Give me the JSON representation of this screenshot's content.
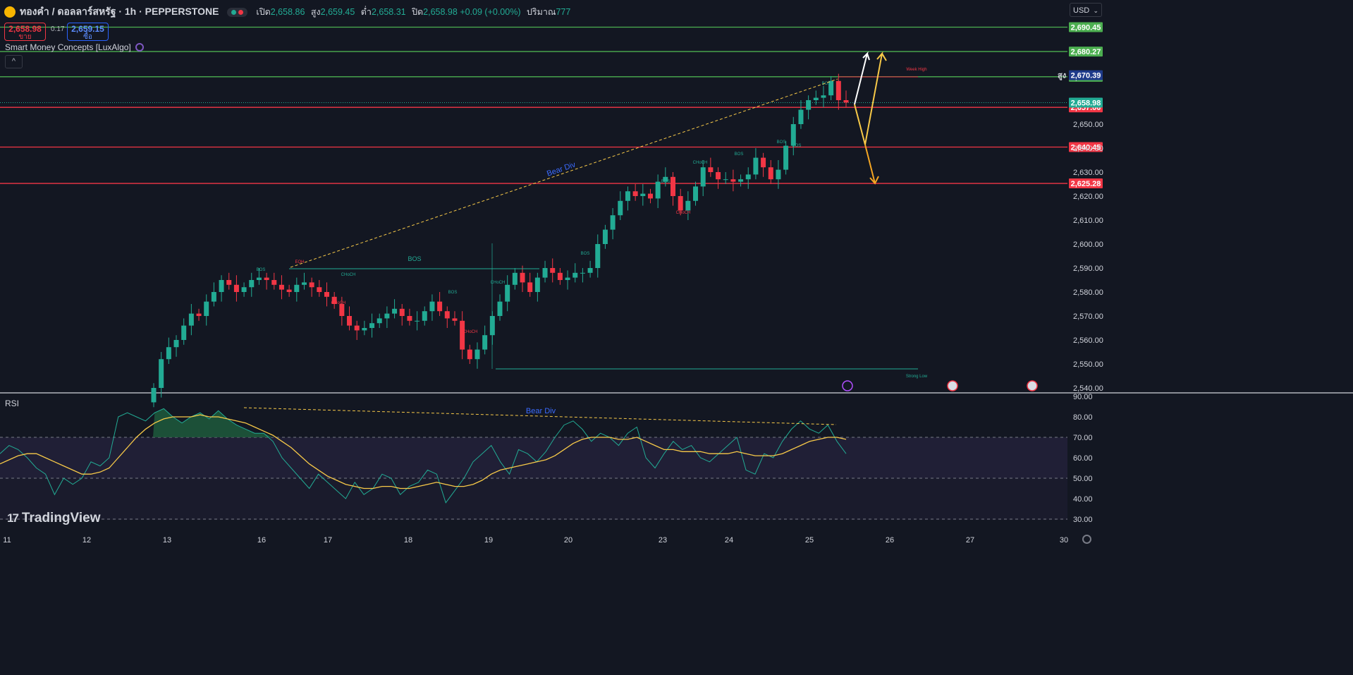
{
  "header": {
    "symbol_title": "ทองคำ / ดอลลาร์สหรัฐ · 1h · PEPPERSTONE",
    "open_label": "เปิด",
    "open_value": "2,658.86",
    "high_label": "สูง",
    "high_value": "2,659.45",
    "low_label": "ต่ำ",
    "low_value": "2,658.31",
    "close_label": "ปิด",
    "close_value": "2,658.98",
    "change_value": "+0.09 (+0.00%)",
    "volume_label": "ปริมาณ",
    "volume_value": "777"
  },
  "trade": {
    "sell_price": "2,658.98",
    "sell_label": "ขาย",
    "spread": "0.17",
    "buy_price": "2,659.15",
    "buy_label": "ซื้อ"
  },
  "currency": {
    "selected": "USD"
  },
  "indicator": {
    "name": "Smart Money Concepts [LuxAlgo]"
  },
  "rsi_panel": {
    "title": "RSI",
    "annotation": "Bear Div"
  },
  "logo": {
    "text": "TradingView"
  },
  "icons": {
    "symbol": "gold-coin-icon",
    "status": "market-status-icon",
    "indicator": "indicator-settings-icon",
    "collapse": "chevron-up-icon",
    "currency": "chevron-down-icon",
    "event_lightning": "lightning-event-icon",
    "event_flag": "us-flag-event-icon",
    "settings": "gear-icon"
  },
  "colors": {
    "background": "#131722",
    "up": "#22ab94",
    "down": "#f23645",
    "support_line": "#f23645",
    "resistance_line": "#4caf50",
    "rsi_line": "#22ab94",
    "rsi_ma": "#f7c948",
    "arrow_white": "#ffffff",
    "arrow_yellow": "#f7c948",
    "arrow_orange": "#f5a623"
  },
  "chart_data": {
    "type": "candlestick",
    "symbol": "XAUUSD 1h",
    "x_tick_labels": [
      "11",
      "12",
      "13",
      "16",
      "17",
      "18",
      "19",
      "20",
      "23",
      "24",
      "25",
      "26",
      "27",
      "30"
    ],
    "y_tick_labels": [
      "2,650.00",
      "2,640.00",
      "2,630.00",
      "2,620.00",
      "2,610.00",
      "2,600.00",
      "2,590.00",
      "2,580.00",
      "2,570.00",
      "2,560.00",
      "2,550.00",
      "2,540.00"
    ],
    "ylim": [
      2538,
      2700
    ],
    "horizontal_levels": [
      {
        "price": 2690.45,
        "label": "2,690.45",
        "kind": "resistance"
      },
      {
        "price": 2680.27,
        "label": "2,680.27",
        "kind": "resistance"
      },
      {
        "price": 2669.76,
        "label": "2,669.76",
        "kind": "resistance"
      },
      {
        "price": 2657.0,
        "label": "2,657.00",
        "kind": "support"
      },
      {
        "price": 2640.45,
        "label": "2,640.45",
        "kind": "support"
      },
      {
        "price": 2625.28,
        "label": "2,625.28",
        "kind": "support"
      }
    ],
    "current_price": {
      "price": 2658.98,
      "label": "2,658.98"
    },
    "session_high": {
      "price": 2670.39,
      "label": "2,670.39",
      "tag": "สูง"
    },
    "smc_labels": [
      {
        "text": "EQH",
        "color": "down"
      },
      {
        "text": "BOS",
        "color": "up"
      },
      {
        "text": "CHoCH",
        "color": "up"
      },
      {
        "text": "CHoCH",
        "color": "down"
      },
      {
        "text": "BOS",
        "color": "up"
      },
      {
        "text": "CHoCH",
        "color": "up"
      },
      {
        "text": "CHoCH",
        "color": "down"
      },
      {
        "text": "BOS",
        "color": "up"
      },
      {
        "text": "BOS",
        "color": "up"
      },
      {
        "text": "CHoCH",
        "color": "up"
      },
      {
        "text": "CHoCH",
        "color": "down"
      },
      {
        "text": "BOS",
        "color": "up"
      },
      {
        "text": "BOS",
        "color": "up"
      },
      {
        "text": "BOS",
        "color": "up"
      },
      {
        "text": "BOS",
        "color": "up"
      }
    ],
    "annotations": [
      "Bear Div",
      "Week High",
      "Strong Low",
      "BOS"
    ],
    "closes": [
      2540,
      2552,
      2557,
      2560,
      2566,
      2571,
      2570,
      2576,
      2580,
      2585,
      2583,
      2580,
      2582,
      2585,
      2586,
      2585,
      2583,
      2581,
      2580,
      2583,
      2584,
      2582,
      2580,
      2578,
      2575,
      2570,
      2566,
      2564,
      2565,
      2567,
      2569,
      2571,
      2573,
      2570,
      2568,
      2568,
      2572,
      2576,
      2572,
      2569,
      2568,
      2556,
      2552,
      2556,
      2562,
      2570,
      2576,
      2583,
      2588,
      2584,
      2580,
      2586,
      2590,
      2588,
      2585,
      2586,
      2588,
      2588,
      2590,
      2600,
      2606,
      2612,
      2618,
      2622,
      2620,
      2621,
      2619,
      2626,
      2628,
      2620,
      2614,
      2618,
      2624,
      2632,
      2630,
      2627,
      2627,
      2626,
      2627,
      2629,
      2636,
      2632,
      2627,
      2631,
      2641,
      2650,
      2656,
      2660,
      2661,
      2662,
      2668,
      2660,
      2659
    ],
    "rsi": {
      "ylim": [
        30,
        90
      ],
      "y_tick_labels": [
        "90.00",
        "80.00",
        "70.00",
        "60.00",
        "50.00",
        "40.00",
        "30.00"
      ],
      "bands": [
        70,
        50,
        30
      ],
      "values": [
        62,
        66,
        64,
        60,
        55,
        52,
        42,
        50,
        47,
        50,
        58,
        56,
        60,
        80,
        82,
        80,
        78,
        82,
        84,
        80,
        77,
        80,
        82,
        79,
        83,
        79,
        76,
        74,
        72,
        72,
        68,
        60,
        55,
        50,
        45,
        52,
        48,
        44,
        40,
        48,
        42,
        45,
        52,
        50,
        42,
        46,
        48,
        54,
        52,
        38,
        44,
        50,
        58,
        62,
        66,
        58,
        52,
        64,
        62,
        58,
        63,
        70,
        76,
        78,
        74,
        68,
        72,
        70,
        66,
        72,
        75,
        60,
        55,
        62,
        68,
        64,
        66,
        60,
        58,
        62,
        66,
        70,
        54,
        52,
        62,
        60,
        68,
        74,
        78,
        74,
        72,
        76,
        68,
        62
      ],
      "ma_values": [
        57,
        59,
        61,
        62,
        62,
        60,
        58,
        56,
        54,
        52,
        52,
        53,
        55,
        60,
        65,
        70,
        74,
        77,
        79,
        80,
        80,
        80,
        81,
        80,
        80,
        79,
        78,
        77,
        75,
        73,
        71,
        68,
        65,
        61,
        57,
        54,
        51,
        49,
        47,
        46,
        45,
        45,
        46,
        46,
        45,
        45,
        46,
        47,
        48,
        47,
        46,
        46,
        47,
        49,
        52,
        54,
        55,
        56,
        57,
        58,
        59,
        61,
        64,
        67,
        69,
        70,
        70,
        70,
        69,
        69,
        70,
        68,
        66,
        64,
        64,
        63,
        63,
        63,
        62,
        62,
        62,
        63,
        62,
        61,
        61,
        61,
        62,
        64,
        66,
        68,
        69,
        70,
        70,
        69
      ]
    }
  }
}
